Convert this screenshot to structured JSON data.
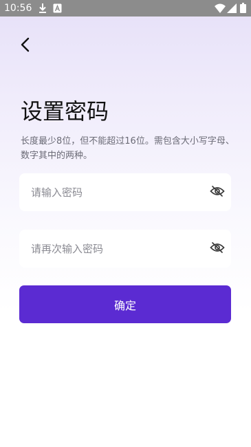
{
  "status_bar": {
    "time": "10:56",
    "icons": [
      "download-icon",
      "notification-a-icon",
      "wifi-icon",
      "signal-icon",
      "battery-icon"
    ]
  },
  "header": {
    "back_icon": "chevron-left-icon"
  },
  "main": {
    "title": "设置密码",
    "hint": "长度最少8位，但不能超过16位。需包含大小写字母、数字其中的两种。",
    "password_field": {
      "placeholder": "请输入密码",
      "value": "",
      "toggle_icon": "eye-hidden-icon"
    },
    "confirm_password_field": {
      "placeholder": "请再次输入密码",
      "value": "",
      "toggle_icon": "eye-hidden-icon"
    },
    "confirm_button_label": "确定"
  },
  "colors": {
    "accent": "#5b2bd2",
    "background_top": "#e6e0f8",
    "background_bottom": "#ffffff",
    "status_bar": "#8c8c8c"
  }
}
